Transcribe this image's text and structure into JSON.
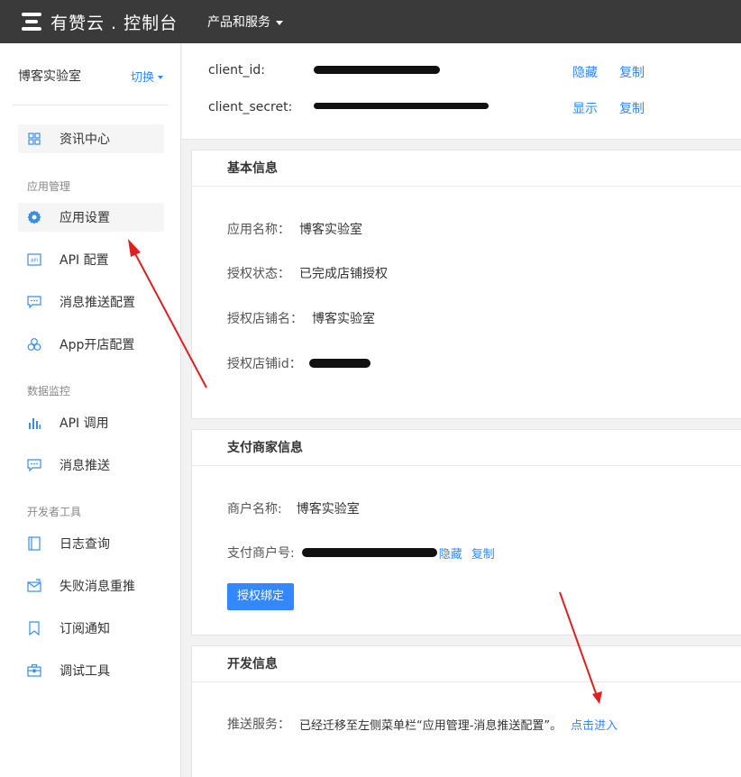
{
  "header": {
    "logo_text": "有赞云 . 控制台",
    "products_label": "产品和服务"
  },
  "sidebar": {
    "shop_name": "博客实验室",
    "switch_label": "切换",
    "top_item": {
      "label": "资讯中心",
      "icon": "grid-icon"
    },
    "groups": [
      {
        "title": "应用管理",
        "items": [
          {
            "label": "应用设置",
            "icon": "gear-icon"
          },
          {
            "label": "API 配置",
            "icon": "api-icon"
          },
          {
            "label": "消息推送配置",
            "icon": "message-config-icon"
          },
          {
            "label": "App开店配置",
            "icon": "app-store-icon"
          }
        ]
      },
      {
        "title": "数据监控",
        "items": [
          {
            "label": "API 调用",
            "icon": "bar-chart-icon"
          },
          {
            "label": "消息推送",
            "icon": "message-icon"
          }
        ]
      },
      {
        "title": "开发者工具",
        "items": [
          {
            "label": "日志查询",
            "icon": "log-icon"
          },
          {
            "label": "失败消息重推",
            "icon": "mail-retry-icon"
          },
          {
            "label": "订阅通知",
            "icon": "bookmark-icon"
          },
          {
            "label": "调试工具",
            "icon": "toolbox-icon"
          }
        ]
      }
    ]
  },
  "credentials": {
    "client_id_label": "client_id:",
    "client_id_hide": "隐藏",
    "client_id_copy": "复制",
    "client_secret_label": "client_secret:",
    "client_secret_show": "显示",
    "client_secret_copy": "复制"
  },
  "basic_info": {
    "title": "基本信息",
    "app_name_label": "应用名称：",
    "app_name_value": "博客实验室",
    "auth_status_label": "授权状态：",
    "auth_status_value": "已完成店铺授权",
    "auth_shop_label": "授权店铺名：",
    "auth_shop_value": "博客实验室",
    "auth_shop_id_label": "授权店铺id："
  },
  "payment_info": {
    "title": "支付商家信息",
    "merchant_name_label": "商户名称:",
    "merchant_name_value": "博客实验室",
    "merchant_no_label": "支付商户号:",
    "merchant_no_hide": "隐藏",
    "merchant_no_copy": "复制",
    "bind_button": "授权绑定"
  },
  "dev_info": {
    "title": "开发信息",
    "push_label": "推送服务：",
    "push_value": "已经迁移至左侧菜单栏“应用管理-消息推送配置”。",
    "push_link": "点击进入"
  },
  "colors": {
    "topbar": "#3a3a3a",
    "accent": "#3388ff",
    "annotation_arrow": "#e02020"
  }
}
